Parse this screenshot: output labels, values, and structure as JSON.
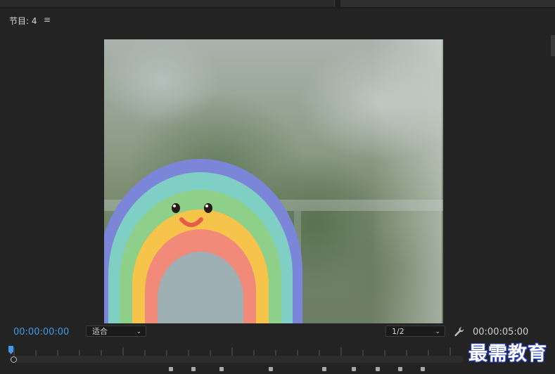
{
  "panel": {
    "title": "节目: 4",
    "menu_glyph": "≡"
  },
  "controls": {
    "current_timecode": "00:00:00:00",
    "fit_select": {
      "value": "适合",
      "caret": "⌄"
    },
    "resolution_select": {
      "value": "1/2",
      "caret": "⌄"
    },
    "settings_icon": "wrench-icon",
    "total_duration": "00:00:05:00"
  },
  "watermark": "最需教育",
  "colors": {
    "accent_blue": "#3d9be9",
    "panel_bg": "#232323",
    "rainbow_outer": "#7b86d9",
    "rainbow_teal": "#7fcfc4",
    "rainbow_green": "#8ecf8a",
    "rainbow_yellow": "#f6c44a",
    "rainbow_pink": "#f28a7a"
  }
}
